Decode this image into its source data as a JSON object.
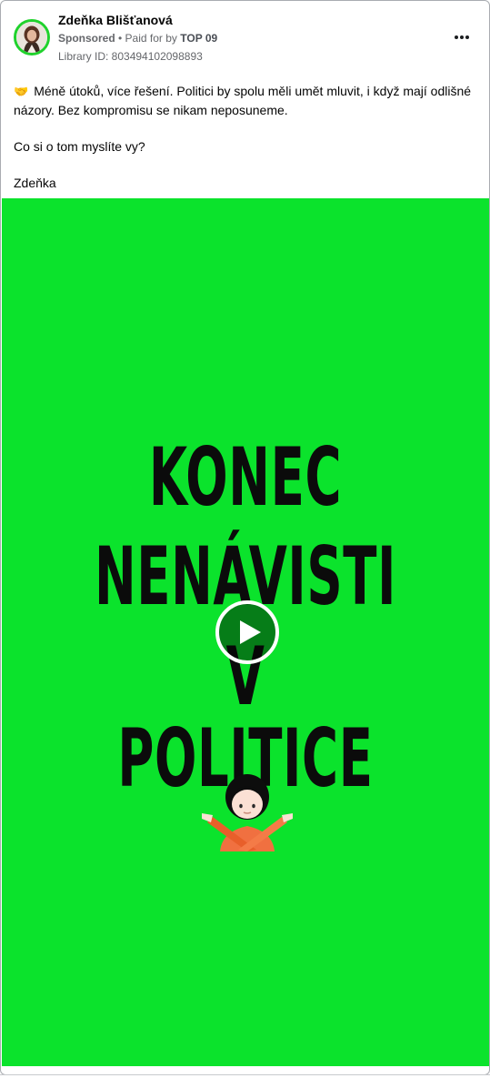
{
  "post": {
    "page_name": "Zdeňka Blišťanová",
    "sponsored": "Sponsored",
    "separator": " • ",
    "paid_for_prefix": "Paid for by ",
    "paid_for_by": "TOP 09",
    "library_id": "Library ID: 803494102098893",
    "more_icon": "more-horizontal-icon"
  },
  "text": {
    "emoji": "🤝",
    "paragraph1": "Méně útoků, více řešení. Politici by spolu měli umět mluvit, i když mají odlišné názory. Bez kompromisu se nikam neposuneme.",
    "paragraph2": "Co si o tom myslíte vy?",
    "signature": "Zdeňka"
  },
  "media": {
    "background_color": "#0be32c",
    "headline": [
      "KONEC",
      "NENÁVISTI",
      "V POLITICE"
    ],
    "play_icon": "play-icon",
    "emoji_icon": "person-gesturing-no-icon"
  }
}
